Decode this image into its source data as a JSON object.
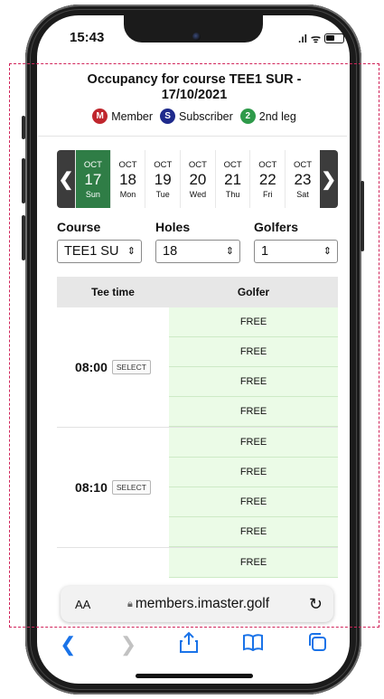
{
  "status": {
    "time": "15:43"
  },
  "page": {
    "title_line1": "Occupancy for course TEE1 SUR -",
    "title_line2": "17/10/2021"
  },
  "legend": [
    {
      "letter": "M",
      "label": "Member",
      "color": "#c0262d"
    },
    {
      "letter": "S",
      "label": "Subscriber",
      "color": "#1e2a8c"
    },
    {
      "letter": "2",
      "label": "2nd leg",
      "color": "#2e9a4a"
    }
  ],
  "dates": [
    {
      "month": "OCT",
      "day": "17",
      "weekday": "Sun"
    },
    {
      "month": "OCT",
      "day": "18",
      "weekday": "Mon"
    },
    {
      "month": "OCT",
      "day": "19",
      "weekday": "Tue"
    },
    {
      "month": "OCT",
      "day": "20",
      "weekday": "Wed"
    },
    {
      "month": "OCT",
      "day": "21",
      "weekday": "Thu"
    },
    {
      "month": "OCT",
      "day": "22",
      "weekday": "Fri"
    },
    {
      "month": "OCT",
      "day": "23",
      "weekday": "Sat"
    }
  ],
  "filters": {
    "course_label": "Course",
    "course_value": "TEE1 SU",
    "holes_label": "Holes",
    "holes_value": "18",
    "golfers_label": "Golfers",
    "golfers_value": "1"
  },
  "table": {
    "col_tee": "Tee time",
    "col_golfer": "Golfer",
    "select_label": "SELECT",
    "groups": [
      {
        "time": "08:00",
        "slots": [
          "FREE",
          "FREE",
          "FREE",
          "FREE"
        ]
      },
      {
        "time": "08:10",
        "slots": [
          "FREE",
          "FREE",
          "FREE",
          "FREE"
        ]
      },
      {
        "time": "",
        "slots": [
          "FREE"
        ]
      }
    ]
  },
  "browser": {
    "aa": "AA",
    "url": "members.imaster.golf"
  },
  "icons": {
    "back": "chevron-left-icon",
    "forward": "chevron-right-icon",
    "share": "share-icon",
    "bookmarks": "book-icon",
    "tabs": "tabs-icon"
  },
  "colors": {
    "selected_day": "#2f7d46",
    "free_slot": "#ebfbe7",
    "link": "#1a73e8",
    "dashed_border": "#d1245a"
  }
}
